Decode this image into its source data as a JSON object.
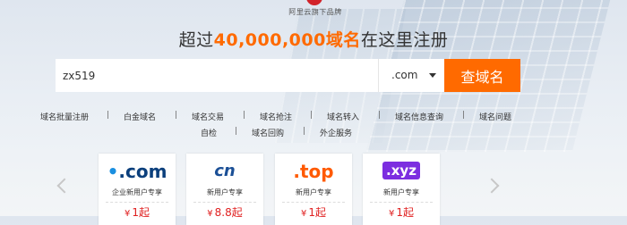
{
  "brand": {
    "logo_text": "阿里云旗下品牌"
  },
  "headline": {
    "prefix": "超过",
    "highlight": "40,000,000域名",
    "suffix": "在这里注册"
  },
  "search": {
    "value": "zx519",
    "tld_value": ".com",
    "button_label": "查域名"
  },
  "quick_links": {
    "row1": [
      "域名批量注册",
      "白金域名",
      "域名交易",
      "域名抢注",
      "域名转入",
      "域名信息查询",
      "域名问题"
    ],
    "row2": [
      "自检",
      "域名回购",
      "外企服务"
    ]
  },
  "colors": {
    "accent": "#ff6a00",
    "price": "#e02020"
  },
  "cards": [
    {
      "logo": ".com",
      "desc": "企业新用户专享",
      "price": "1起",
      "currency": "¥"
    },
    {
      "logo": "cn",
      "desc": "新用户专享",
      "price": "8.8起",
      "currency": "¥"
    },
    {
      "logo": ".top",
      "desc": "新用户专享",
      "price": "1起",
      "currency": "¥"
    },
    {
      "logo": ".xyz",
      "desc": "新用户专享",
      "price": "1起",
      "currency": "¥"
    }
  ]
}
